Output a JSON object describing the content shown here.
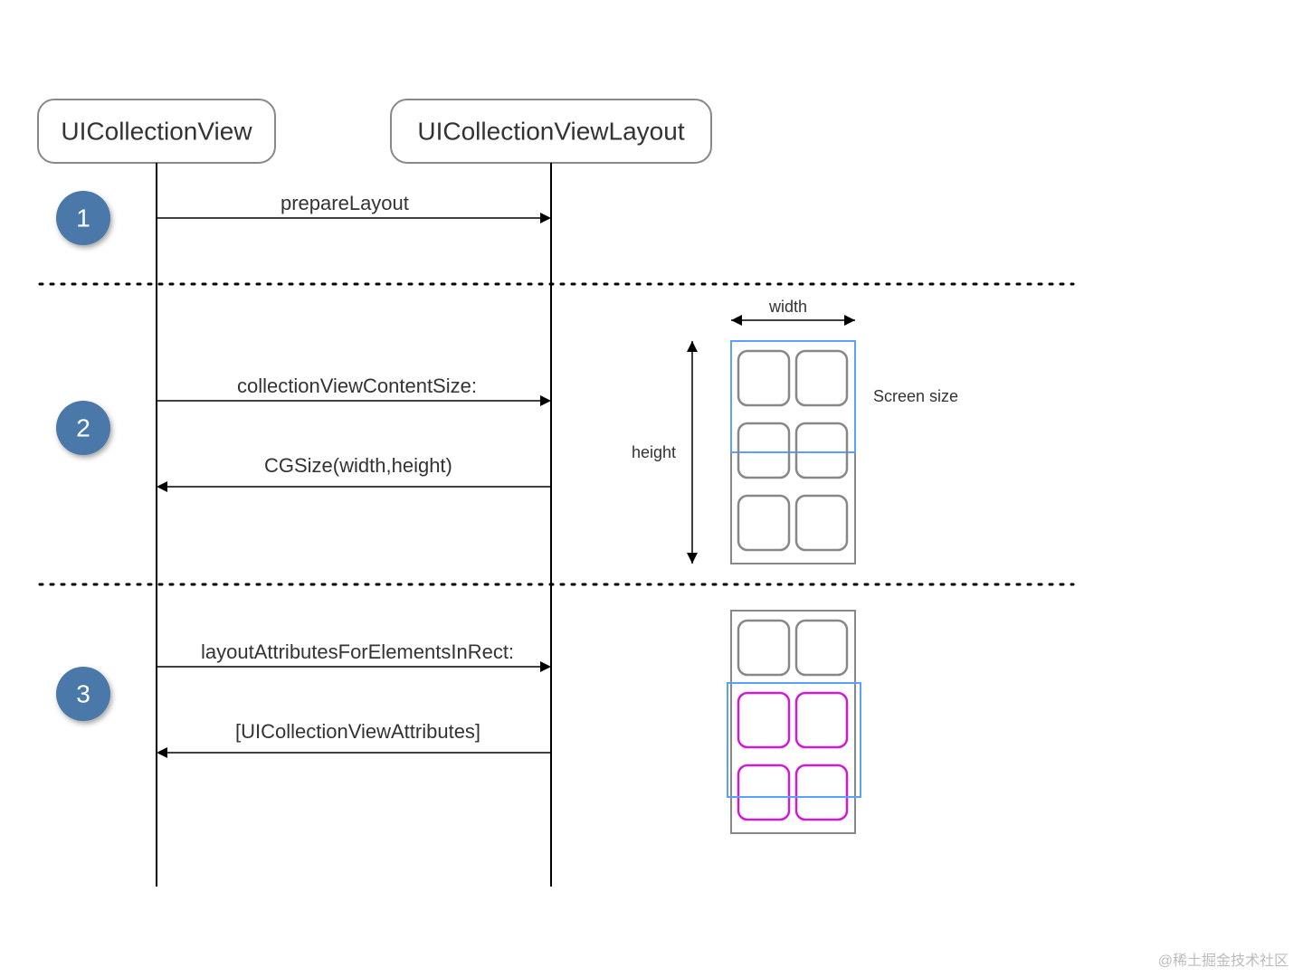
{
  "lifelines": {
    "left": "UICollectionView",
    "right": "UICollectionViewLayout"
  },
  "steps": {
    "s1": {
      "num": "1",
      "msg1": "prepareLayout"
    },
    "s2": {
      "num": "2",
      "msg1": "collectionViewContentSize:",
      "msg2": "CGSize(width,height)"
    },
    "s3": {
      "num": "3",
      "msg1": "layoutAttributesForElementsInRect:",
      "msg2": "[UICollectionViewAttributes]"
    }
  },
  "sizeDiagram": {
    "width": "width",
    "height": "height",
    "screen": "Screen size"
  },
  "watermark": "@稀土掘金技术社区"
}
